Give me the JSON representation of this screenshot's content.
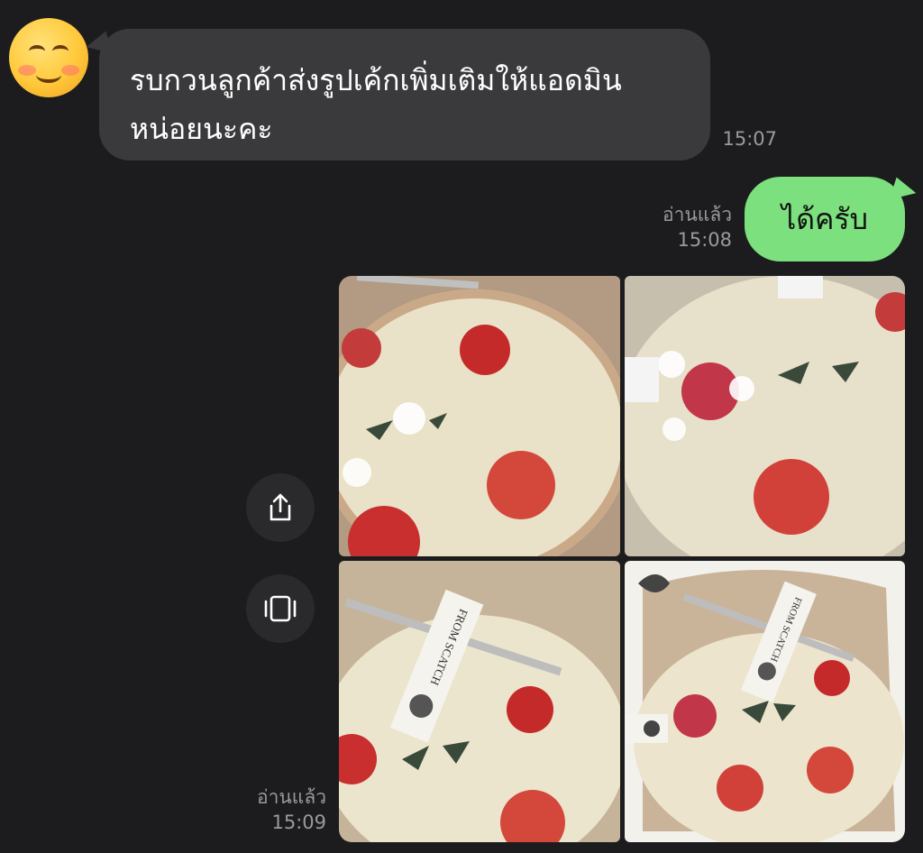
{
  "messages": {
    "incoming": {
      "avatar_icon": "smiling-face-emoji-icon",
      "line1": "รบกวนลูกค้าส่งรูปเค้กเพิ่มเติมให้แอดมิน",
      "line2": "หน่อยนะคะ",
      "time": "15:07"
    },
    "outgoing_text": {
      "text": "ได้ครับ",
      "read_label": "อ่านแล้ว",
      "time": "15:08",
      "bubble_color": "#7be07d"
    },
    "outgoing_photos": {
      "read_label": "อ่านแล้ว",
      "time": "15:09",
      "photos": [
        {
          "label": "cake-photo-1"
        },
        {
          "label": "cake-photo-2"
        },
        {
          "label": "cake-photo-3",
          "tag_text": "FROM SCATCH"
        },
        {
          "label": "cake-photo-4",
          "tag_text": "FROM SCATCH"
        }
      ],
      "actions": {
        "share_icon": "share-icon",
        "slideshow_icon": "slideshow-icon"
      }
    }
  },
  "theme": {
    "background": "#1c1c1e",
    "incoming_bubble": "#3a3a3c",
    "timestamp_color": "#9a9a9e"
  }
}
